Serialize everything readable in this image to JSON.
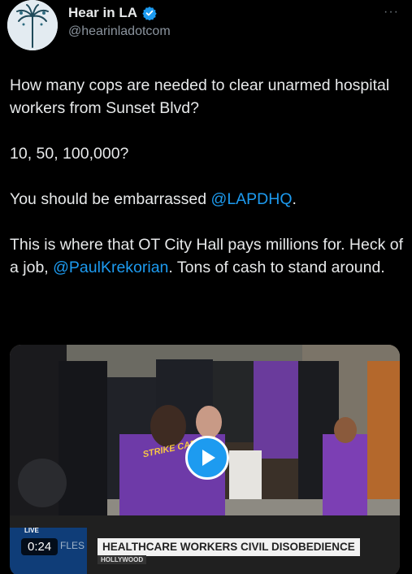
{
  "account": {
    "display_name": "Hear in LA",
    "handle": "@hearinladotcom",
    "verified": true,
    "avatar_icon": "palm-tree-icon"
  },
  "more_menu_glyph": "···",
  "tweet": {
    "line1": "How many cops are needed to clear unarmed hospital workers from Sunset Blvd?",
    "line2": "10, 50, 100,000?",
    "line3_prefix": "You should be embarrassed ",
    "line3_mention": "@LAPDHQ",
    "line3_suffix": ".",
    "line4_prefix": "This is where that OT City Hall pays millions for. Heck of a job, ",
    "line4_mention": "@PaulKrekorian",
    "line4_suffix": ". Tons of cash to stand around."
  },
  "video": {
    "duration": "0:24",
    "live_tag": "LIVE",
    "chyron_left": "FLES",
    "chyron": "HEALTHCARE WORKERS CIVIL DISOBEDIENCE",
    "chyron_sub": "HOLLYWOOD",
    "shirt_text": "STRIKE CAPTAIN"
  },
  "colors": {
    "background": "#000000",
    "text": "#e7e9ea",
    "secondary_text": "#8b949e",
    "accent": "#1d9bf0"
  }
}
